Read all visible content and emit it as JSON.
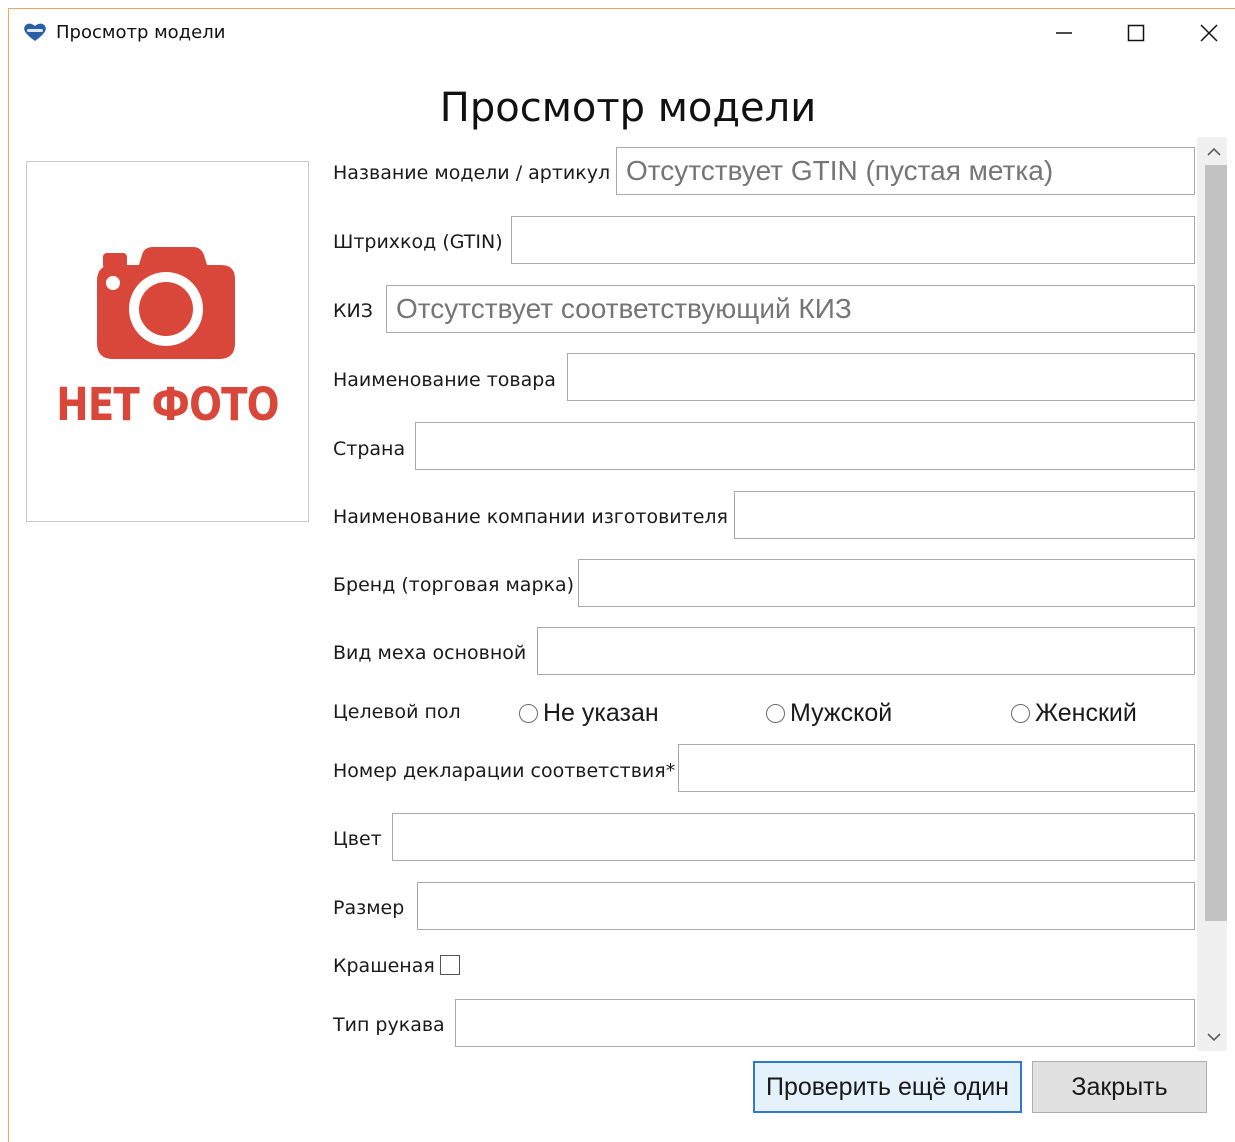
{
  "window": {
    "title": "Просмотр модели",
    "controls": {
      "minimize": "minimize-icon",
      "maximize": "maximize-icon",
      "close": "close-icon"
    }
  },
  "page": {
    "heading": "Просмотр модели"
  },
  "photo": {
    "placeholder_text": "НЕТ ФОТО",
    "icon": "camera-icon",
    "accent": "#d9473a"
  },
  "form": {
    "model_name": {
      "label": "Название модели / артикул",
      "value": "Отсутствует GTIN (пустая метка)"
    },
    "barcode": {
      "label": "Штрихкод (GTIN)",
      "value": ""
    },
    "kiz": {
      "label": "КИЗ",
      "value": "Отсутствует соответствующий КИЗ"
    },
    "product_name": {
      "label": "Наименование товара",
      "value": ""
    },
    "country": {
      "label": "Страна",
      "value": ""
    },
    "manufacturer": {
      "label": "Наименование компании изготовителя",
      "value": ""
    },
    "brand": {
      "label": "Бренд (торговая марка)",
      "value": ""
    },
    "fur_type": {
      "label": "Вид меха основной",
      "value": ""
    },
    "target_gender": {
      "label": "Целевой пол",
      "options": [
        "Не указан",
        "Мужской",
        "Женский"
      ],
      "selected": null
    },
    "declaration": {
      "label": "Номер декларации соответствия*",
      "value": ""
    },
    "color": {
      "label": "Цвет",
      "value": ""
    },
    "size": {
      "label": "Размер",
      "value": ""
    },
    "dyed": {
      "label": "Крашеная",
      "checked": false
    },
    "sleeve_type": {
      "label": "Тип рукава",
      "value": ""
    }
  },
  "buttons": {
    "check_another": "Проверить ещё один",
    "close": "Закрыть"
  }
}
